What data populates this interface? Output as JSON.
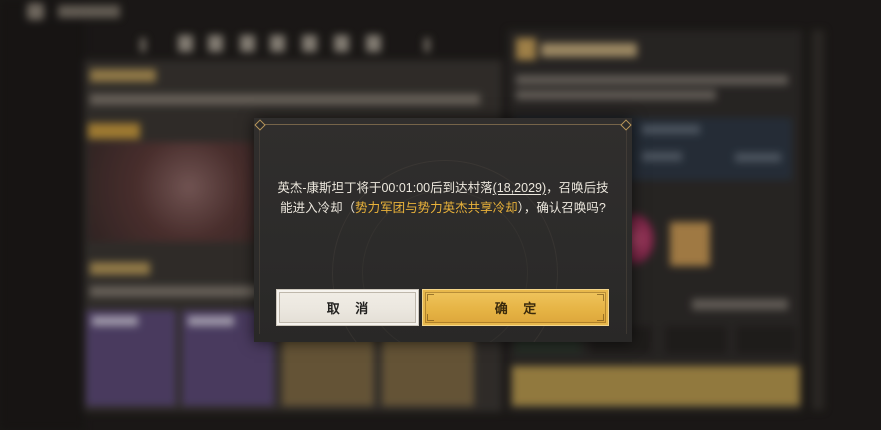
{
  "dialog": {
    "message": {
      "line1_prefix": "英杰-康斯坦丁将于00:01:00后到达村落",
      "location_link": "(18,2029)",
      "line1_suffix": "，召唤后技",
      "line2_prefix": "能进入冷却（",
      "highlight": "势力军团与势力英杰共享冷却",
      "line2_suffix": "），确认召唤吗?"
    },
    "cancel_label": "取 消",
    "confirm_label": "确 定"
  },
  "colors": {
    "accent": "#e6b445",
    "highlight": "#e9b23a",
    "msg": "#ece7dd",
    "dlg": "#2c2b2a",
    "cancel": "#ece8e0"
  }
}
